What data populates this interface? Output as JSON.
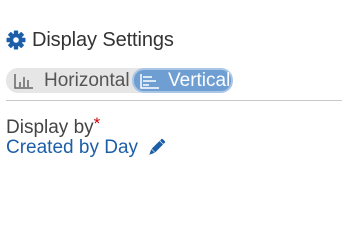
{
  "header": {
    "title": "Display Settings",
    "icon": "gear-icon"
  },
  "orientation": {
    "options": [
      {
        "label": "Horizontal",
        "icon": "bar-chart-icon",
        "selected": false
      },
      {
        "label": "Vertical",
        "icon": "horizontal-bars-icon",
        "selected": true
      }
    ]
  },
  "display_by": {
    "label": "Display by",
    "required_marker": "*",
    "value": "Created by Day",
    "edit_icon": "pencil-icon"
  },
  "colors": {
    "accent": "#6f9ed2",
    "link": "#1c5fa8",
    "required": "#cc0000"
  }
}
